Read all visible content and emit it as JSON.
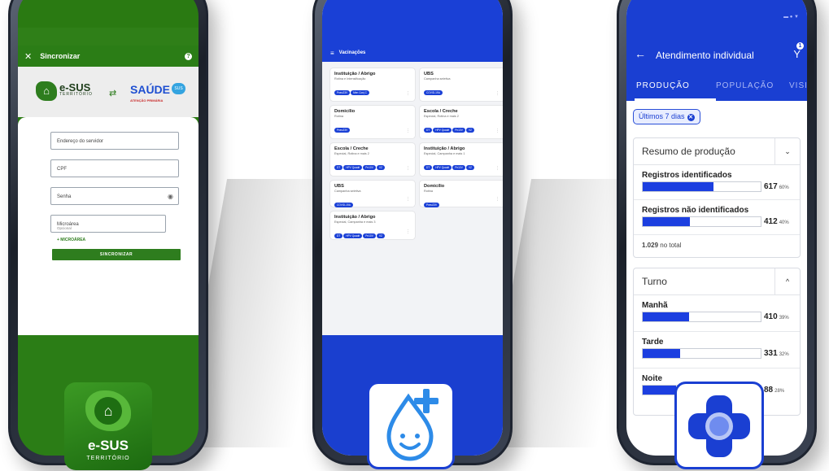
{
  "phone1": {
    "appbar_close": "✕",
    "appbar_title": "Sincronizar",
    "help_icon": "?",
    "logo_esus": "e-SUS",
    "logo_esus_sub": "TERRITÓRIO",
    "sync_arrows": "⇄",
    "logo_saude": "SAÚDE",
    "logo_saude_sus": "SUS",
    "logo_saude_sub": "ATENÇÃO PRIMÁRIA",
    "fields": [
      "Endereço do servidor",
      "CPF",
      "Senha",
      "Microárea"
    ],
    "optional_label": "Opcional",
    "add_microarea": "+ MICROÁREA",
    "sync_button": "SINCRONIZAR"
  },
  "phone2": {
    "appbar_menu": "≡",
    "appbar_title": "Vacinações",
    "cards": [
      {
        "title": "Instituição / Abrigo",
        "sub": "Rotina e Intensificação",
        "chips": [
          "Pneu23V",
          "Men Conj C"
        ]
      },
      {
        "title": "UBS",
        "sub": "Campanha seletiva",
        "chips": [
          "COVID-19A"
        ]
      },
      {
        "title": "Domicílio",
        "sub": "Rotina",
        "chips": [
          "Pneu23V"
        ]
      },
      {
        "title": "Escola / Creche",
        "sub": "Especial, Rotina e mais 2",
        "chips": [
          "DT",
          "HPV Quadri",
          "Pn10V",
          "VZ"
        ]
      },
      {
        "title": "Escola / Creche",
        "sub": "Especial, Rotina e mais 2",
        "chips": [
          "DT",
          "HPV Quadri",
          "Pn10V",
          "VZ"
        ]
      },
      {
        "title": "Instituição / Abrigo",
        "sub": "Especial, Campanha e mais 1",
        "chips": [
          "DT",
          "HPV Quadri",
          "Pn10V",
          "VZ"
        ]
      },
      {
        "title": "UBS",
        "sub": "Campanha seletiva",
        "chips": [
          "COVID-19A"
        ]
      },
      {
        "title": "Domicílio",
        "sub": "Rotina",
        "chips": [
          "Pneu23V"
        ]
      },
      {
        "title": "Instituição / Abrigo",
        "sub": "Especial, Campanha e mais 3",
        "chips": [
          "DT",
          "HPV Quadri",
          "Pn10V",
          "VZ"
        ]
      }
    ],
    "more_icon": "⋮"
  },
  "phone3": {
    "status_icons": "▬ ● ▼",
    "back_icon": "←",
    "appbar_title": "Atendimento individual",
    "filter_icon": "Y",
    "filter_badge": "1",
    "tabs": [
      "PRODUÇÃO",
      "POPULAÇÃO",
      "VISITA"
    ],
    "filter_chip": "Últimos 7 dias",
    "filter_chip_close": "✕",
    "panel1": {
      "title": "Resumo de produção",
      "chevron": "⌄",
      "rows": [
        {
          "label": "Registros identificados",
          "value": "617",
          "pct": "60%",
          "fill": 0.6
        },
        {
          "label": "Registros não identificados",
          "value": "412",
          "pct": "40%",
          "fill": 0.4
        }
      ],
      "total_value": "1.029",
      "total_label": "no total"
    },
    "panel2": {
      "title": "Turno",
      "chevron": "^",
      "rows": [
        {
          "label": "Manhã",
          "value": "410",
          "pct": "39%",
          "fill": 0.39
        },
        {
          "label": "Tarde",
          "value": "331",
          "pct": "32%",
          "fill": 0.32
        },
        {
          "label": "Noite",
          "value": "88",
          "pct": "28%",
          "fill": 0.28
        }
      ]
    }
  },
  "app_icons": {
    "esus_house": "⌂",
    "esus_name": "e-SUS",
    "esus_sub": "TERRITÓRIO"
  },
  "colors": {
    "esus_green": "#2b7d16",
    "brand_blue": "#1a40d6",
    "bar_blue": "#1c3fe0"
  }
}
